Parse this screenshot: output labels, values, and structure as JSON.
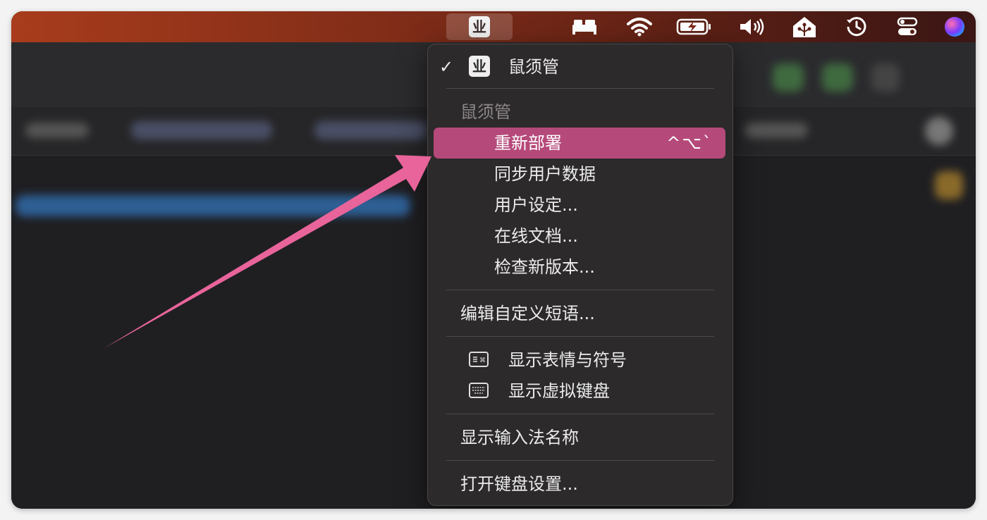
{
  "menubar": {
    "ime_glyph": "业",
    "icons": [
      "bed-icon",
      "wifi-icon",
      "battery-charging-icon",
      "volume-icon",
      "home-icon",
      "time-machine-icon",
      "control-center-icon",
      "siri-icon"
    ]
  },
  "menu": {
    "current_ime": "鼠须管",
    "section_header": "鼠须管",
    "items": [
      {
        "label": "重新部署",
        "shortcut": "^⌥`",
        "highlighted": true
      },
      {
        "label": "同步用户数据"
      },
      {
        "label": "用户设定..."
      },
      {
        "label": "在线文档..."
      },
      {
        "label": "检查新版本..."
      }
    ],
    "edit_phrases": "编辑自定义短语...",
    "show_emoji": "显示表情与符号",
    "show_keyboard": "显示虚拟键盘",
    "show_ime_name": "显示输入法名称",
    "open_keyboard_settings": "打开键盘设置..."
  },
  "colors": {
    "highlight": "#b5497a",
    "arrow": "#e8649a",
    "menu_bg": "#2d2a2b"
  }
}
